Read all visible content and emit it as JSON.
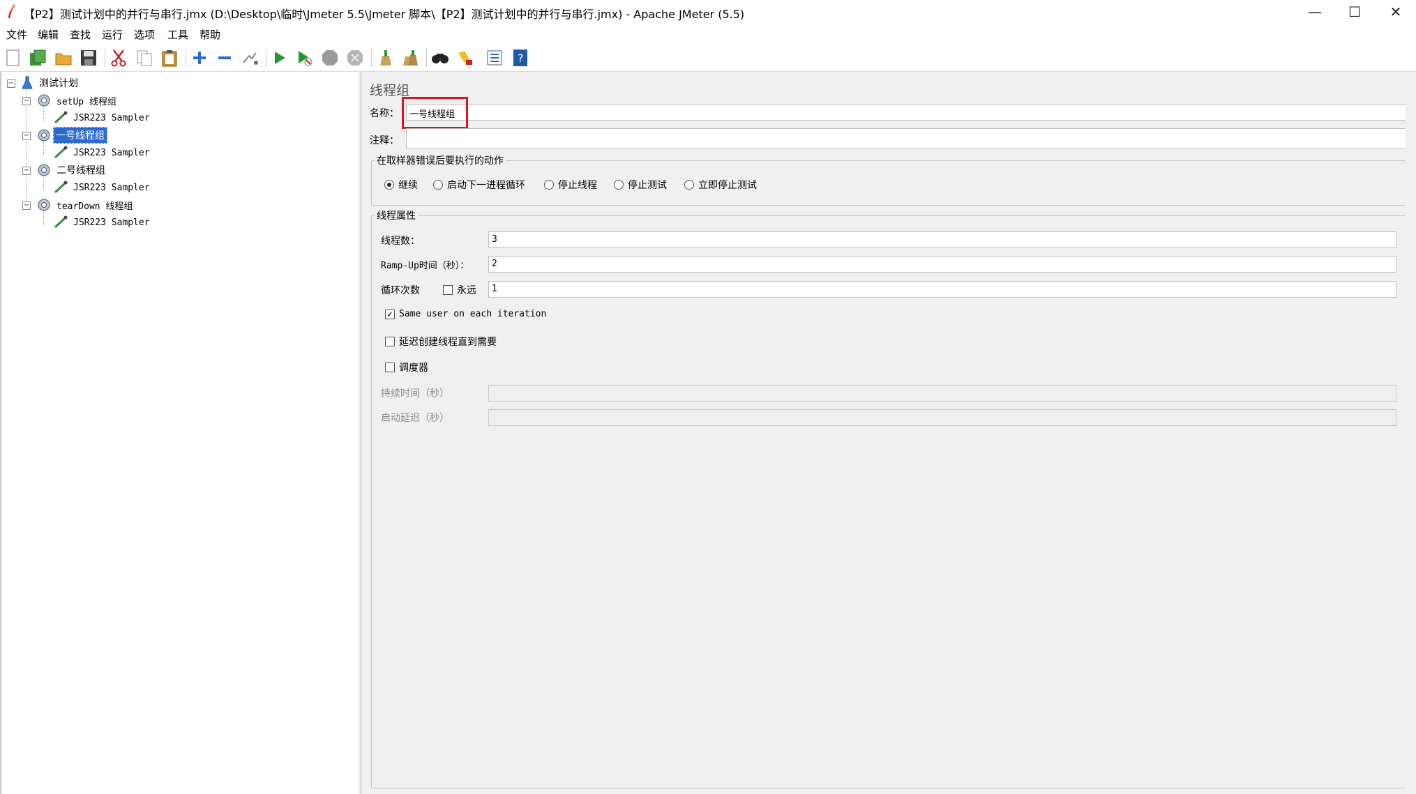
{
  "window": {
    "title": "【P2】测试计划中的并行与串行.jmx (D:\\Desktop\\临时\\Jmeter 5.5\\Jmeter 脚本\\【P2】测试计划中的并行与串行.jmx) - Apache JMeter (5.5)",
    "minimize": "—",
    "maximize": "☐",
    "close": "✕"
  },
  "menu": [
    "文件",
    "编辑",
    "查找",
    "运行",
    "选项",
    "工具",
    "帮助"
  ],
  "toolbar": [
    "new-icon",
    "templates-icon",
    "open-icon",
    "save-icon",
    "cut-icon",
    "copy-icon",
    "paste-icon",
    "expand-icon",
    "collapse-icon",
    "toggle-icon",
    "start-icon",
    "start-no-pause-icon",
    "stop-icon",
    "shutdown-icon",
    "clear-icon",
    "clear-all-icon",
    "search-icon",
    "reset-search-icon",
    "function-helper-icon",
    "help-icon"
  ],
  "tree": {
    "root": "测试计划",
    "groups": [
      {
        "name": "setUp 线程组",
        "child": "JSR223 Sampler"
      },
      {
        "name": "一号线程组",
        "child": "JSR223 Sampler",
        "selected": true
      },
      {
        "name": "二号线程组",
        "child": "JSR223 Sampler"
      },
      {
        "name": "tearDown 线程组",
        "child": "JSR223 Sampler"
      }
    ]
  },
  "form": {
    "panel_title": "线程组",
    "name_label": "名称：",
    "name_value": "一号线程组",
    "comment_label": "注释：",
    "comment_value": "",
    "error_group_title": "在取样器错误后要执行的动作",
    "error_actions": [
      {
        "label": "继续",
        "selected": true
      },
      {
        "label": "启动下一进程循环",
        "selected": false
      },
      {
        "label": "停止线程",
        "selected": false
      },
      {
        "label": "停止测试",
        "selected": false
      },
      {
        "label": "立即停止测试",
        "selected": false
      }
    ],
    "thread_props_title": "线程属性",
    "threads_label": "线程数：",
    "threads_value": "3",
    "rampup_label": "Ramp-Up时间（秒）：",
    "rampup_value": "2",
    "loop_label": "循环次数",
    "forever_label": "永远",
    "forever_checked": false,
    "loop_value": "1",
    "same_user_label": "Same user on each iteration",
    "same_user_checked": true,
    "delay_label": "延迟创建线程直到需要",
    "delay_checked": false,
    "scheduler_label": "调度器",
    "scheduler_checked": false,
    "duration_label": "持续时间（秒）",
    "duration_value": "",
    "startup_delay_label": "启动延迟（秒）",
    "startup_delay_value": ""
  },
  "colors": {
    "selection": "#2a6ad1",
    "highlight": "#e0141e",
    "panel_bg": "#f0f0f0"
  }
}
